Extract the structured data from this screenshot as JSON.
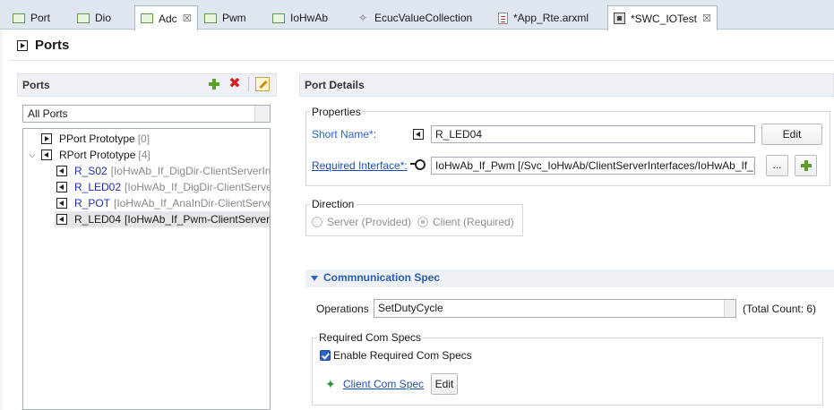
{
  "tabs": [
    {
      "label": "Port",
      "icon": "module-icon",
      "active": false
    },
    {
      "label": "Dio",
      "icon": "module-icon",
      "active": false
    },
    {
      "label": "Adc",
      "icon": "module-icon",
      "active": true,
      "close": "☒"
    },
    {
      "label": "Pwm",
      "icon": "module-icon",
      "active": false
    },
    {
      "label": "IoHwAb",
      "icon": "module-icon",
      "active": false
    },
    {
      "label": "EcucValueCollection",
      "icon": "gear-icon",
      "active": false
    },
    {
      "label": "*App_Rte.arxml",
      "icon": "arxml-file-icon",
      "active": false
    },
    {
      "label": "*SWC_IOTest",
      "icon": "component-icon",
      "active": false,
      "close": "☒"
    }
  ],
  "page": {
    "title": "Ports"
  },
  "ports_panel": {
    "title": "Ports",
    "filter_value": "All Ports",
    "toolbar": {
      "add": "add-icon",
      "delete": "delete-icon",
      "edit": "edit-icon",
      "delete_glyph": "✖"
    },
    "tree": {
      "pport": {
        "label": "PPort Prototype",
        "count": "[0]"
      },
      "rport": {
        "label": "RPort Prototype",
        "count": "[4]"
      },
      "items": [
        {
          "name": "R_S02",
          "iface": "[IoHwAb_If_DigDir-ClientServerInt"
        },
        {
          "name": "R_LED02",
          "iface": "[IoHwAb_If_DigDir-ClientServer"
        },
        {
          "name": "R_POT",
          "iface": "[IoHwAb_If_AnaInDir-ClientServer"
        },
        {
          "name": "R_LED04",
          "iface": "[IoHwAb_If_Pwm-ClientServerIn"
        }
      ],
      "selected_index": 3
    }
  },
  "port_details": {
    "title": "Port Details",
    "properties": {
      "label": "Properties",
      "short_name_label": "Short Name*:",
      "short_name_value": "R_LED04",
      "edit_button": "Edit",
      "required_interface_label": "Required Interface*:",
      "required_interface_value": "IoHwAb_If_Pwm [/Svc_IoHwAb/ClientServerInterfaces/IoHwAb_If_P",
      "browse_button": "..."
    },
    "direction": {
      "label": "Direction",
      "server_label": "Server (Provided)",
      "client_label": "Client (Required)",
      "selected": "client"
    },
    "communication_spec": {
      "title": "Commnunication Spec",
      "operations_label": "Operations",
      "operations_value": "SetDutyCycle",
      "total_count": "(Total Count: 6)",
      "required_com_specs": {
        "label": "Required Com Specs",
        "enable_label": "Enable Required Com Specs",
        "enabled": true,
        "client_com_spec_link": "Client Com Spec",
        "edit_button": "Edit"
      }
    }
  }
}
